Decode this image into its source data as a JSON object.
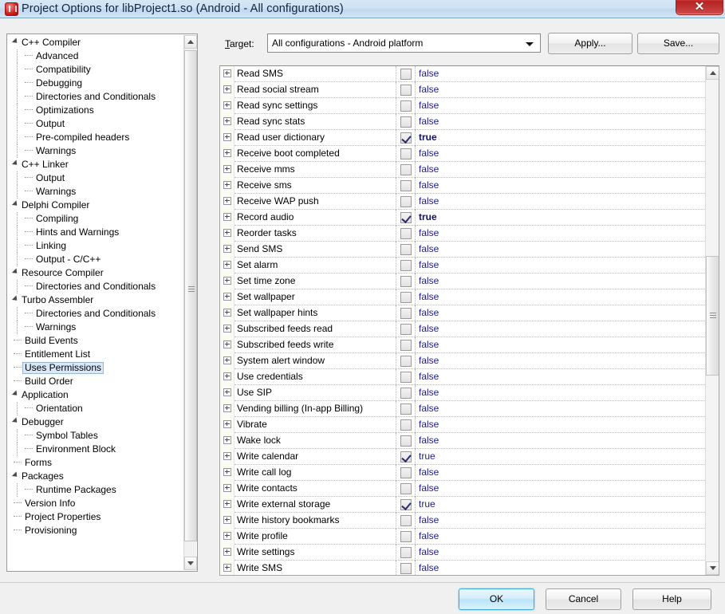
{
  "window": {
    "title": "Project Options for libProject1.so  (Android - All configurations)",
    "close_label": "✕",
    "app_icon": "project-icon"
  },
  "target": {
    "label_prefix": "T",
    "label_rest": "arget:",
    "value": "All configurations - Android platform",
    "apply_label": "Apply...",
    "save_label": "Save..."
  },
  "footer": {
    "ok_label": "OK",
    "cancel_label": "Cancel",
    "help_label": "Help"
  },
  "tree": {
    "selected": "Uses Permissions",
    "items": [
      {
        "label": "C++ Compiler",
        "level": 0,
        "expandable": true
      },
      {
        "label": "Advanced",
        "level": 1,
        "expandable": false
      },
      {
        "label": "Compatibility",
        "level": 1,
        "expandable": false
      },
      {
        "label": "Debugging",
        "level": 1,
        "expandable": false
      },
      {
        "label": "Directories and Conditionals",
        "level": 1,
        "expandable": false
      },
      {
        "label": "Optimizations",
        "level": 1,
        "expandable": false
      },
      {
        "label": "Output",
        "level": 1,
        "expandable": false
      },
      {
        "label": "Pre-compiled headers",
        "level": 1,
        "expandable": false
      },
      {
        "label": "Warnings",
        "level": 1,
        "expandable": false
      },
      {
        "label": "C++ Linker",
        "level": 0,
        "expandable": true
      },
      {
        "label": "Output",
        "level": 1,
        "expandable": false
      },
      {
        "label": "Warnings",
        "level": 1,
        "expandable": false
      },
      {
        "label": "Delphi Compiler",
        "level": 0,
        "expandable": true
      },
      {
        "label": "Compiling",
        "level": 1,
        "expandable": false
      },
      {
        "label": "Hints and Warnings",
        "level": 1,
        "expandable": false
      },
      {
        "label": "Linking",
        "level": 1,
        "expandable": false
      },
      {
        "label": "Output - C/C++",
        "level": 1,
        "expandable": false
      },
      {
        "label": "Resource Compiler",
        "level": 0,
        "expandable": true
      },
      {
        "label": "Directories and Conditionals",
        "level": 1,
        "expandable": false
      },
      {
        "label": "Turbo Assembler",
        "level": 0,
        "expandable": true
      },
      {
        "label": "Directories and Conditionals",
        "level": 1,
        "expandable": false
      },
      {
        "label": "Warnings",
        "level": 1,
        "expandable": false
      },
      {
        "label": "Build Events",
        "level": 0,
        "expandable": false
      },
      {
        "label": "Entitlement List",
        "level": 0,
        "expandable": false
      },
      {
        "label": "Uses Permissions",
        "level": 0,
        "expandable": false
      },
      {
        "label": "Build Order",
        "level": 0,
        "expandable": false
      },
      {
        "label": "Application",
        "level": 0,
        "expandable": true
      },
      {
        "label": "Orientation",
        "level": 1,
        "expandable": false
      },
      {
        "label": "Debugger",
        "level": 0,
        "expandable": true
      },
      {
        "label": "Symbol Tables",
        "level": 1,
        "expandable": false
      },
      {
        "label": "Environment Block",
        "level": 1,
        "expandable": false
      },
      {
        "label": "Forms",
        "level": 0,
        "expandable": false
      },
      {
        "label": "Packages",
        "level": 0,
        "expandable": true
      },
      {
        "label": "Runtime Packages",
        "level": 1,
        "expandable": false
      },
      {
        "label": "Version Info",
        "level": 0,
        "expandable": false
      },
      {
        "label": "Project Properties",
        "level": 0,
        "expandable": false
      },
      {
        "label": "Provisioning",
        "level": 0,
        "expandable": false
      }
    ]
  },
  "grid": {
    "rows": [
      {
        "name": "Read SMS",
        "checked": false,
        "value": "false",
        "bold": false
      },
      {
        "name": "Read social stream",
        "checked": false,
        "value": "false",
        "bold": false
      },
      {
        "name": "Read sync settings",
        "checked": false,
        "value": "false",
        "bold": false
      },
      {
        "name": "Read sync stats",
        "checked": false,
        "value": "false",
        "bold": false
      },
      {
        "name": "Read user dictionary",
        "checked": true,
        "value": "true",
        "bold": true
      },
      {
        "name": "Receive boot completed",
        "checked": false,
        "value": "false",
        "bold": false
      },
      {
        "name": "Receive mms",
        "checked": false,
        "value": "false",
        "bold": false
      },
      {
        "name": "Receive sms",
        "checked": false,
        "value": "false",
        "bold": false
      },
      {
        "name": "Receive WAP push",
        "checked": false,
        "value": "false",
        "bold": false
      },
      {
        "name": "Record audio",
        "checked": true,
        "value": "true",
        "bold": true
      },
      {
        "name": "Reorder tasks",
        "checked": false,
        "value": "false",
        "bold": false
      },
      {
        "name": "Send SMS",
        "checked": false,
        "value": "false",
        "bold": false
      },
      {
        "name": "Set alarm",
        "checked": false,
        "value": "false",
        "bold": false
      },
      {
        "name": "Set time zone",
        "checked": false,
        "value": "false",
        "bold": false
      },
      {
        "name": "Set wallpaper",
        "checked": false,
        "value": "false",
        "bold": false
      },
      {
        "name": "Set wallpaper hints",
        "checked": false,
        "value": "false",
        "bold": false
      },
      {
        "name": "Subscribed feeds read",
        "checked": false,
        "value": "false",
        "bold": false
      },
      {
        "name": "Subscribed feeds write",
        "checked": false,
        "value": "false",
        "bold": false
      },
      {
        "name": "System alert window",
        "checked": false,
        "value": "false",
        "bold": false
      },
      {
        "name": "Use credentials",
        "checked": false,
        "value": "false",
        "bold": false
      },
      {
        "name": "Use SIP",
        "checked": false,
        "value": "false",
        "bold": false
      },
      {
        "name": "Vending billing (In-app Billing)",
        "checked": false,
        "value": "false",
        "bold": false
      },
      {
        "name": "Vibrate",
        "checked": false,
        "value": "false",
        "bold": false
      },
      {
        "name": "Wake lock",
        "checked": false,
        "value": "false",
        "bold": false
      },
      {
        "name": "Write calendar",
        "checked": true,
        "value": "true",
        "bold": false
      },
      {
        "name": "Write call log",
        "checked": false,
        "value": "false",
        "bold": false
      },
      {
        "name": "Write contacts",
        "checked": false,
        "value": "false",
        "bold": false
      },
      {
        "name": "Write external storage",
        "checked": true,
        "value": "true",
        "bold": false
      },
      {
        "name": "Write history bookmarks",
        "checked": false,
        "value": "false",
        "bold": false
      },
      {
        "name": "Write profile",
        "checked": false,
        "value": "false",
        "bold": false
      },
      {
        "name": "Write settings",
        "checked": false,
        "value": "false",
        "bold": false
      },
      {
        "name": "Write SMS",
        "checked": false,
        "value": "false",
        "bold": false
      }
    ]
  }
}
